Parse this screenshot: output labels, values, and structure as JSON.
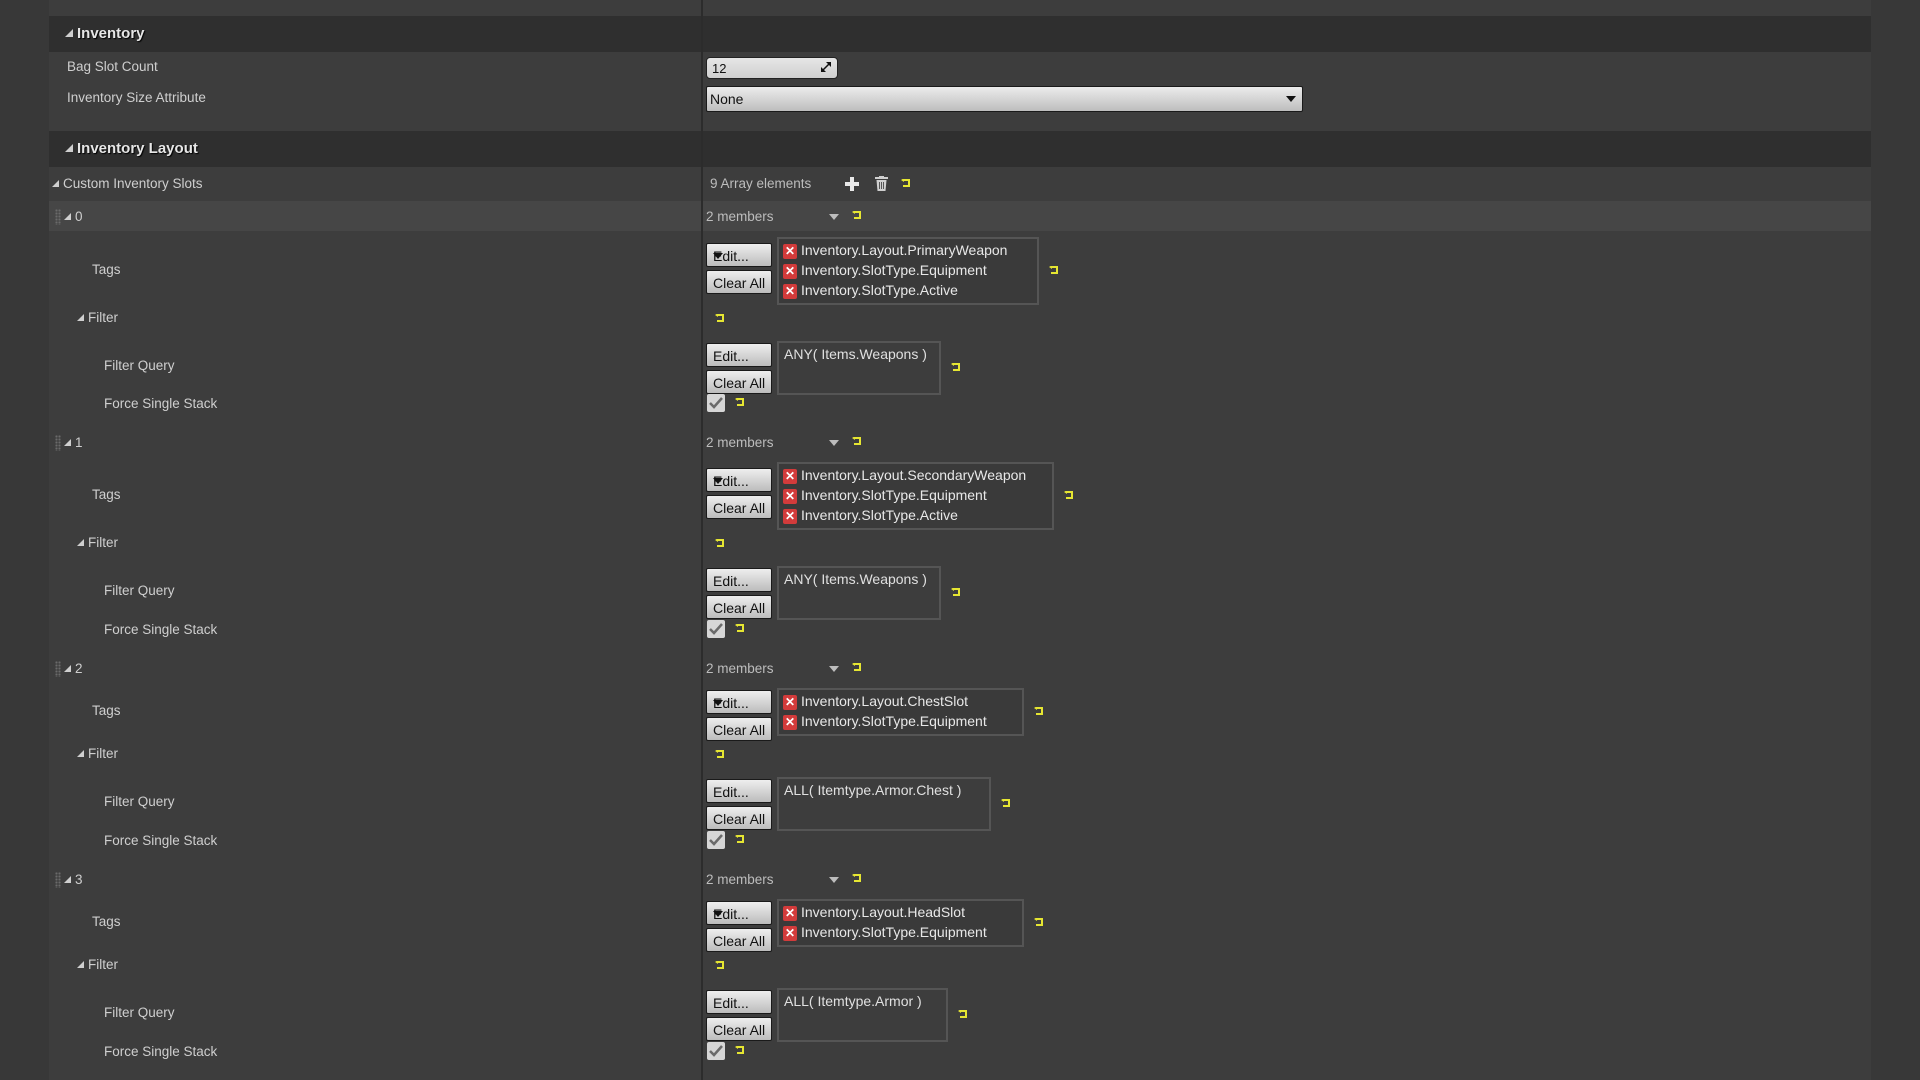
{
  "categories": {
    "inventory": "Inventory",
    "layout": "Inventory Layout"
  },
  "inventory": {
    "bag_slot_count_label": "Bag Slot Count",
    "bag_slot_count_value": "12",
    "size_attribute_label": "Inventory Size Attribute",
    "size_attribute_value": "None"
  },
  "custom_slots": {
    "label": "Custom Inventory Slots",
    "count_text": "9 Array elements",
    "icons": [
      "add-icon",
      "trash-icon",
      "reset-icon"
    ],
    "field_labels": {
      "tags": "Tags",
      "filter": "Filter",
      "filter_query": "Filter Query",
      "force_single_stack": "Force Single Stack"
    },
    "buttons": {
      "edit": "Edit...",
      "clear_all": "Clear All"
    },
    "elements": [
      {
        "index": "0",
        "members": "2 members",
        "tags": [
          "Inventory.Layout.PrimaryWeapon",
          "Inventory.SlotType.Equipment",
          "Inventory.SlotType.Active"
        ],
        "filter_query": "ANY( Items.Weapons )",
        "force_single_stack": true
      },
      {
        "index": "1",
        "members": "2 members",
        "tags": [
          "Inventory.Layout.SecondaryWeapon",
          "Inventory.SlotType.Equipment",
          "Inventory.SlotType.Active"
        ],
        "filter_query": "ANY( Items.Weapons )",
        "force_single_stack": true
      },
      {
        "index": "2",
        "members": "2 members",
        "tags": [
          "Inventory.Layout.ChestSlot",
          "Inventory.SlotType.Equipment"
        ],
        "filter_query": "ALL( Itemtype.Armor.Chest )",
        "force_single_stack": true
      },
      {
        "index": "3",
        "members": "2 members",
        "tags": [
          "Inventory.Layout.HeadSlot",
          "Inventory.SlotType.Equipment"
        ],
        "filter_query": "ALL( Itemtype.Armor )",
        "force_single_stack": true
      }
    ]
  },
  "colors": {
    "reset_arrow": "#e6e632",
    "tag_remove": "#d23b3b",
    "category_bg": "#2f2f2f",
    "panel_bg": "#3d3d3d",
    "row_highlight": "#464646"
  }
}
